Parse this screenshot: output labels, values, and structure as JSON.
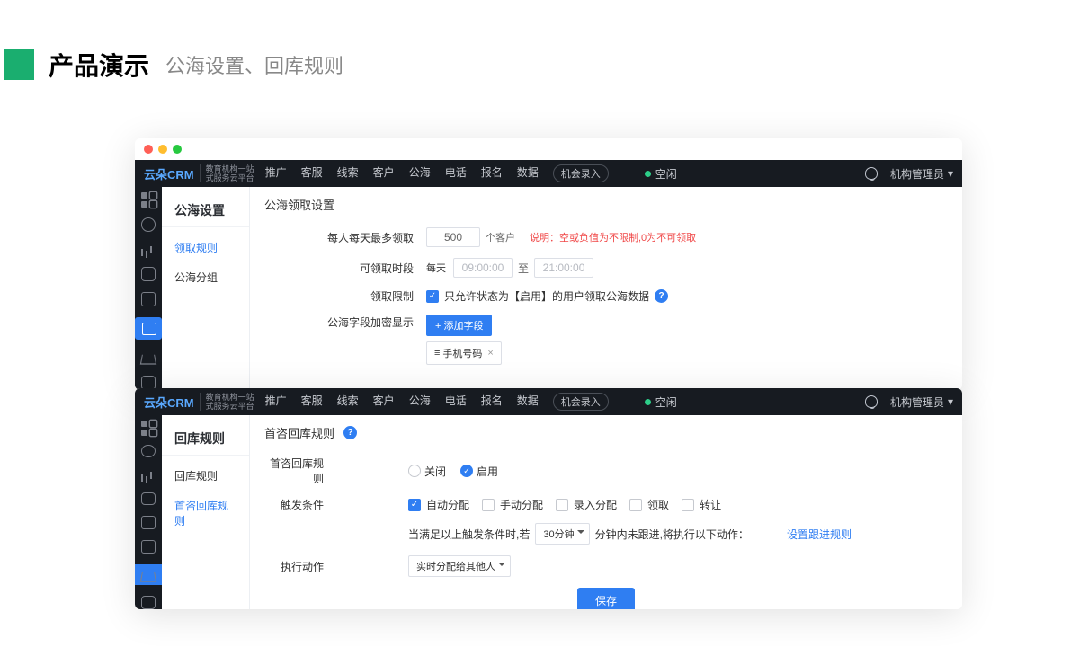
{
  "slide": {
    "title": "产品演示",
    "sub": "公海设置、回库规则"
  },
  "top": {
    "logo": "云朵CRM",
    "logo_sub1": "教育机构一站",
    "logo_sub2": "式服务云平台",
    "menu": [
      "推广",
      "客服",
      "线索",
      "客户",
      "公海",
      "电话",
      "报名",
      "数据"
    ],
    "btn": "机会录入",
    "status": "空闲",
    "user": "机构管理员"
  },
  "w1": {
    "side_head": "公海设置",
    "side_items": [
      "领取规则",
      "公海分组"
    ],
    "active": 0,
    "title": "公海领取设置",
    "r1_label": "每人每天最多领取",
    "r1_val": "500",
    "r1_unit": "个客户",
    "r1_note": "说明：空或负值为不限制,0为不可领取",
    "r2_label": "可领取时段",
    "r2_daily": "每天",
    "r2_from": "09:00:00",
    "r2_mid": "至",
    "r2_to": "21:00:00",
    "r3_label": "领取限制",
    "r3_chk": "只允许状态为【启用】的用户领取公海数据",
    "r4_label": "公海字段加密显示",
    "r4_btn": "+ 添加字段",
    "r4_tag": "手机号码"
  },
  "w2": {
    "side_head": "回库规则",
    "side_items": [
      "回库规则",
      "首咨回库规则"
    ],
    "active": 1,
    "title": "首咨回库规则",
    "r1_label": "首咨回库规则",
    "r1_off": "关闭",
    "r1_on": "启用",
    "r2_label": "触发条件",
    "r2_c1": "自动分配",
    "r2_c2": "手动分配",
    "r2_c3": "录入分配",
    "r2_c4": "领取",
    "r2_c5": "转让",
    "r3_pre": "当满足以上触发条件时,若",
    "r3_dd": "30分钟",
    "r3_mid": "分钟内未跟进,将执行以下动作：",
    "r3_link": "设置跟进规则",
    "r4_label": "执行动作",
    "r4_dd": "实时分配给其他人",
    "save": "保存"
  }
}
